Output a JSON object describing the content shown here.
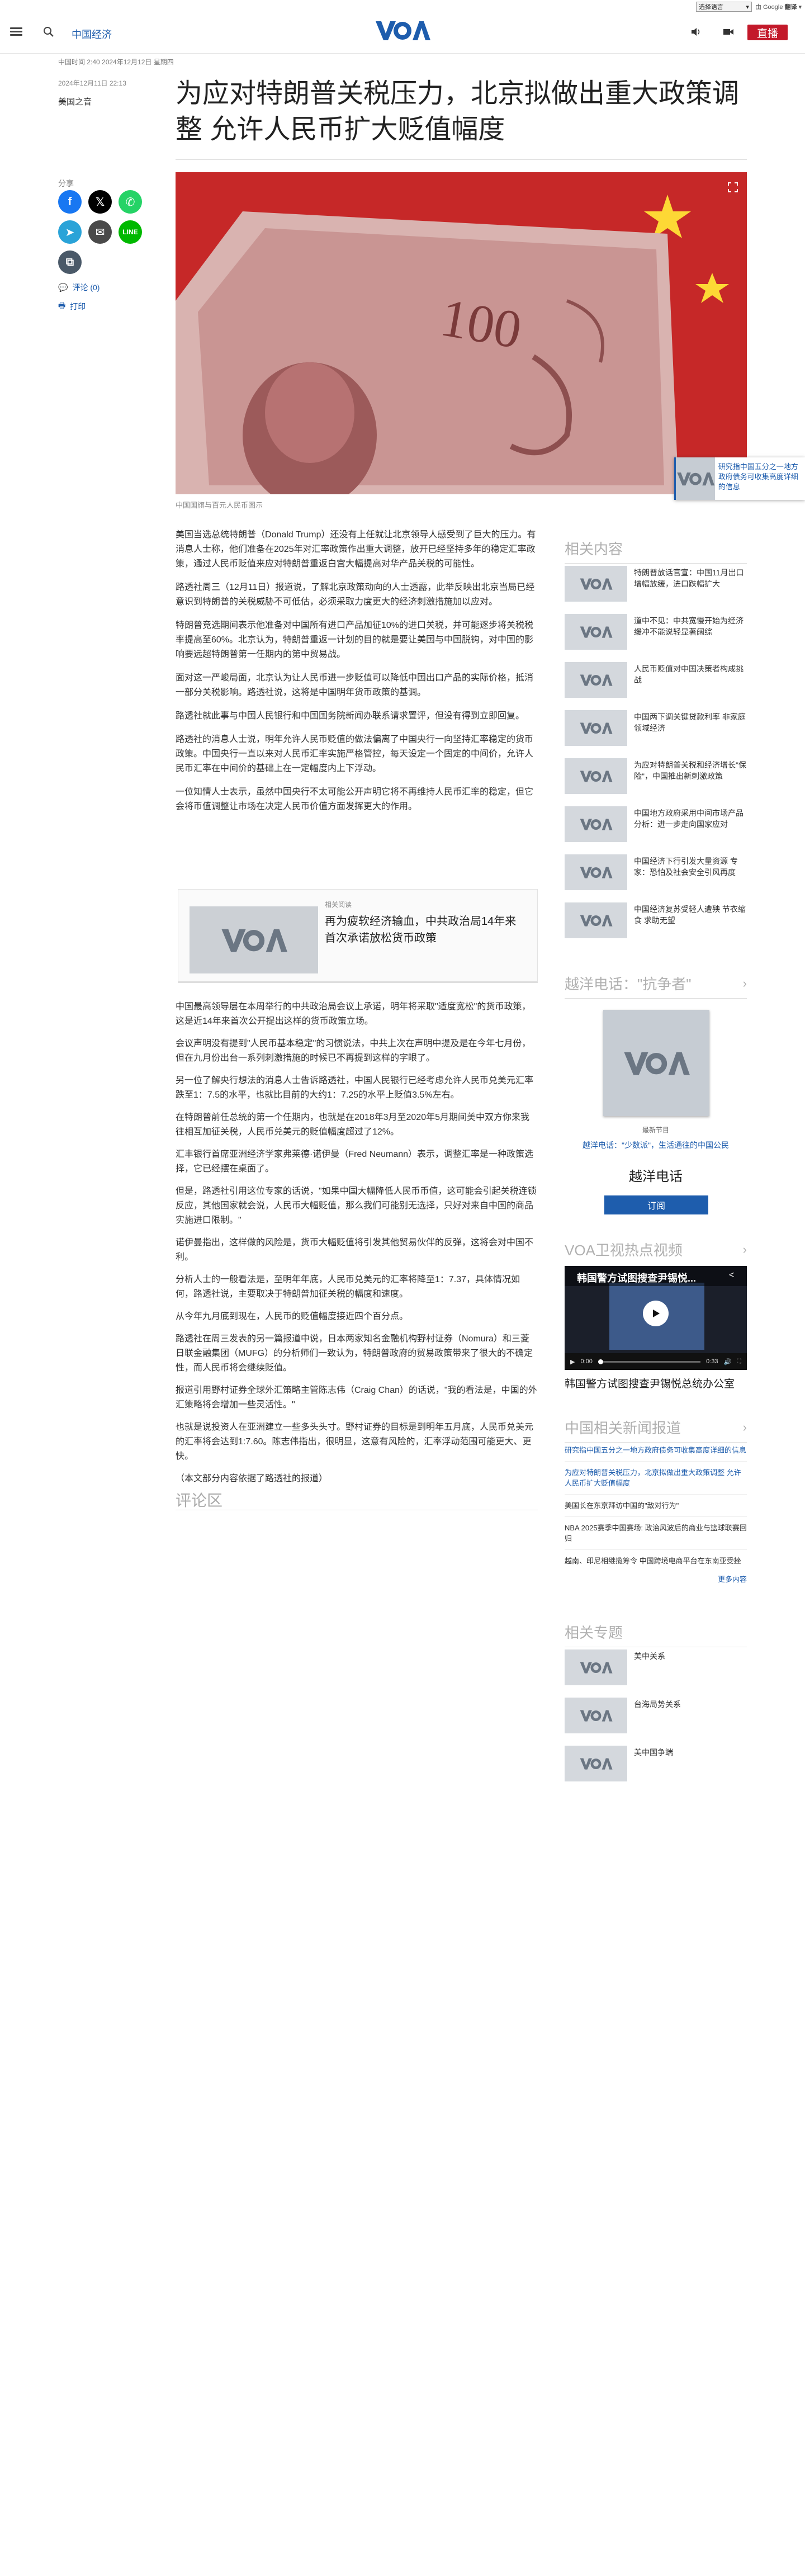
{
  "lang_bar": {
    "select_label": "选择语言",
    "powered_by": "由 Google",
    "translate_label": "翻译"
  },
  "header": {
    "section_link": "中国经济",
    "live_label": "直播"
  },
  "article": {
    "dateline": "中国时间 2:40 2024年12月12日 星期四",
    "date": "2024年12月11日 22:13",
    "byline": "美国之音",
    "title": "为应对特朗普关税压力，北京拟做出重大政策调整 允许人民币扩大贬值幅度",
    "caption": "中国国旗与百元人民币图示",
    "paragraphs_a": [
      "美国当选总统特朗普（Donald Trump）还没有上任就让北京领导人感受到了巨大的压力。有消息人士称，他们准备在2025年对汇率政策作出重大调整，放开已经坚持多年的稳定汇率政策，通过人民币贬值来应对特朗普重返白宫大幅提高对华产品关税的可能性。",
      "路透社周三（12月11日）报道说，了解北京政策动向的人士透露，此举反映出北京当局已经意识到特朗普的关税威胁不可低估，必须采取力度更大的经济刺激措施加以应对。",
      "特朗普竞选期间表示他准备对中国所有进口产品加征10%的进口关税，并可能逐步将关税税率提高至60%。北京认为，特朗普重返一计划的目的就是要让美国与中国脱钩，对中国的影响要远超特朗普第一任期内的第中贸易战。",
      "面对这一严峻局面，北京认为让人民币进一步贬值可以降低中国出口产品的实际价格，抵消一部分关税影响。路透社说，这将是中国明年货币政策的基调。",
      "路透社就此事与中国人民银行和中国国务院新闻办联系请求置评，但没有得到立即回复。",
      "路透社的消息人士说，明年允许人民币贬值的做法偏离了中国央行一向坚持汇率稳定的货币政策。中国央行一直以来对人民币汇率实施严格管控，每天设定一个固定的中间价，允许人民币汇率在中间价的基础上在一定幅度内上下浮动。",
      "一位知情人士表示，虽然中国央行不太可能公开声明它将不再维持人民币汇率的稳定，但它会将币值调整让市场在决定人民币价值方面发挥更大的作用。"
    ],
    "related": {
      "label": "相关阅读",
      "title": "再为疲软经济输血，中共政治局14年来首次承诺放松货币政策"
    },
    "paragraphs_b": [
      "中国最高领导层在本周举行的中共政治局会议上承诺，明年将采取\"适度宽松\"的货币政策，这是近14年来首次公开提出这样的货币政策立场。",
      "会议声明没有提到\"人民币基本稳定\"的习惯说法，中共上次在声明中提及是在今年七月份，但在九月份出台一系列刺激措施的时候已不再提到这样的字眼了。",
      "另一位了解央行想法的消息人士告诉路透社，中国人民银行已经考虑允许人民币兑美元汇率跌至1：7.5的水平，也就比目前的大约1：7.25的水平上贬值3.5%左右。",
      "在特朗普前任总统的第一个任期内，也就是在2018年3月至2020年5月期间美中双方你来我往相互加征关税，人民币兑美元的贬值幅度超过了12%。",
      "汇丰银行首席亚洲经济学家弗莱德·诺伊曼（Fred Neumann）表示，调整汇率是一种政策选择，它已经摆在桌面了。",
      "但是，路透社引用这位专家的话说，\"如果中国大幅降低人民币币值，这可能会引起关税连锁反应，其他国家就会说，人民币大幅贬值，那么我们可能别无选择，只好对来自中国的商品实施进口限制。\"",
      "诺伊曼指出，这样做的风险是，货币大幅贬值将引发其他贸易伙伴的反弹，这将会对中国不利。",
      "分析人士的一般看法是，至明年年底，人民币兑美元的汇率将降至1：7.37，具体情况如何，路透社说，主要取决于特朗普加征关税的幅度和速度。",
      "从今年九月底到现在，人民币的贬值幅度接近四个百分点。",
      "路透社在周三发表的另一篇报道中说，日本两家知名金融机构野村证券（Nomura）和三菱日联金融集团（MUFG）的分析师们一致认为，特朗普政府的贸易政策带来了很大的不确定性，而人民币将会继续贬值。",
      "报道引用野村证券全球外汇策略主管陈志伟（Craig Chan）的话说，\"我的看法是，中国的外汇策略将会增加一些灵活性。\"",
      "也就是说投资人在亚洲建立一些多头头寸。野村证券的目标是到明年五月底，人民币兑美元的汇率将会达到1:7.60。陈志伟指出，很明显，这意有风险的，汇率浮动范围可能更大、更快。"
    ],
    "closing": "（本文部分内容依据了路透社的报道）",
    "comments_title": "评论区"
  },
  "share": {
    "label": "分享",
    "comments": "评论 (0)",
    "print": "打印"
  },
  "float_card": {
    "text": "研究指中国五分之一地方政府债务可收集高度详细的信息"
  },
  "rail": {
    "related_title": "相关内容",
    "related_items": [
      "特朗普放话官宣：中国11月出口增幅放缓，进口跌幅扩大",
      "道中不见：中共宽慢开始为经济缓冲不能说轻显著阔综",
      "人民币贬值对中国决策者构成挑战",
      "中国两下调关键贷款利率 非家庭领域经济",
      "为应对特朗普关税和经济增长\"保险\"，中国推出新刺激政策",
      "中国地方政府采用中间市场产品分析：进一步走向国家应对",
      "中国经济下行引发大量资源 专家：恐怕及社会安全引风再度",
      "中国经济复苏受轻人遭殃 节衣缩食 求助无望"
    ],
    "hotline_title": "越洋电话：\"抗争者\"",
    "hotline_tag": "最新节目",
    "hotline_link": "越洋电话：\"少数派\"，生活通往的中国公民",
    "hotline_name": "越洋电话",
    "subscribe": "订阅",
    "video_title": "VOA卫视热点视频",
    "video_overlay": "韩国警方试图搜查尹锡悦...",
    "video_time_current": "0:00",
    "video_time_total": "0:33",
    "video_caption": "韩国警方试图搜查尹锡悦总统办公室",
    "china_title": "中国相关新闻报道",
    "china_items": [
      "研究指中国五分之一地方政府债务可收集高度详细的信息",
      "为应对特朗普关税压力，北京拟做出重大政策调整 允许人民币扩大贬值幅度",
      "美国长在东京拜访中国的\"敌对行为\"",
      "NBA 2025赛季中国赛场: 政治风波后的商业与篮球联赛回归",
      "越南、印尼相继揽筹令 中国跨境电商平台在东南亚受挫"
    ],
    "more": "更多内容",
    "topics_title": "相关专题",
    "topics": [
      "美中关系",
      "台海局势关系",
      "美中国争端"
    ]
  },
  "colors": {
    "brand": "#1e5dad",
    "live": "#c3192a",
    "facebook": "#1877f2",
    "x": "#000000",
    "whatsapp": "#25d366",
    "telegram": "#2aa3d8",
    "email": "#4a4a4a",
    "line": "#00b900",
    "copy": "#4a5968"
  },
  "icons": {
    "menu": "hamburger-icon",
    "search": "search-icon",
    "audio": "speaker-icon",
    "video": "video-icon",
    "expand": "expand-icon"
  }
}
